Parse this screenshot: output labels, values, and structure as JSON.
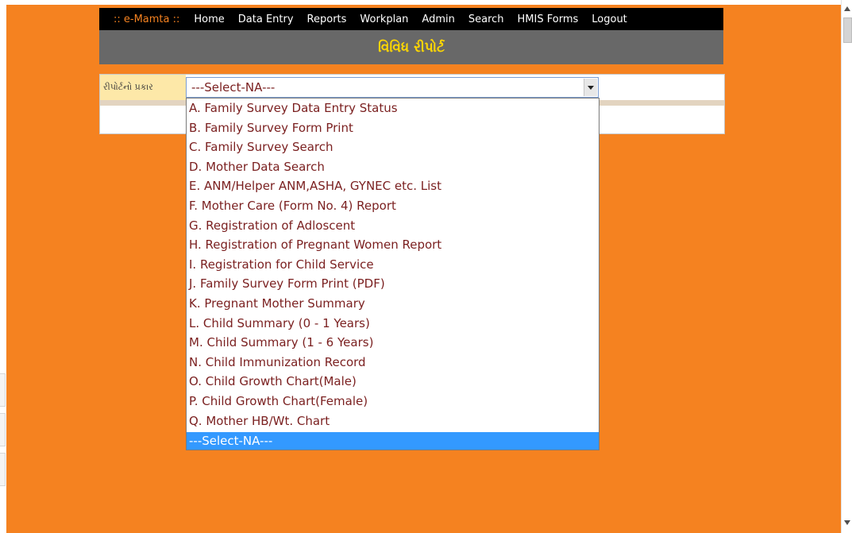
{
  "nav": {
    "brand": ":: e-Mamta ::",
    "items": [
      "Home",
      "Data Entry",
      "Reports",
      "Workplan",
      "Admin",
      "Search",
      "HMIS Forms",
      "Logout"
    ]
  },
  "banner": {
    "title": "વિવિધ રીપોર્ટ"
  },
  "form": {
    "label": "રીપોર્ટનો પ્રકાર",
    "selected_value": "---Select-NA---"
  },
  "dropdown": {
    "options": [
      "A. Family Survey Data Entry Status",
      "B. Family Survey Form Print",
      "C. Family Survey Search",
      "D. Mother Data Search",
      "E. ANM/Helper ANM,ASHA, GYNEC etc. List",
      "F. Mother Care (Form No. 4) Report",
      "G. Registration of Adloscent",
      "H. Registration of Pregnant Women Report",
      "I. Registration for Child Service",
      "J. Family Survey Form Print (PDF)",
      "K. Pregnant Mother Summary",
      "L. Child Summary (0 - 1 Years)",
      "M. Child Summary (1 - 6 Years)",
      "N. Child Immunization Record",
      "O. Child Growth Chart(Male)",
      "P. Child Growth Chart(Female)",
      "Q. Mother HB/Wt. Chart"
    ],
    "highlighted_option": "---Select-NA---"
  },
  "colors": {
    "page_background": "#f58220",
    "navbar": "#000000",
    "brand": "#f58220",
    "banner": "#686868",
    "banner_text": "#ffd700",
    "option_text": "#7a1f1f",
    "highlight": "#3399ff"
  }
}
